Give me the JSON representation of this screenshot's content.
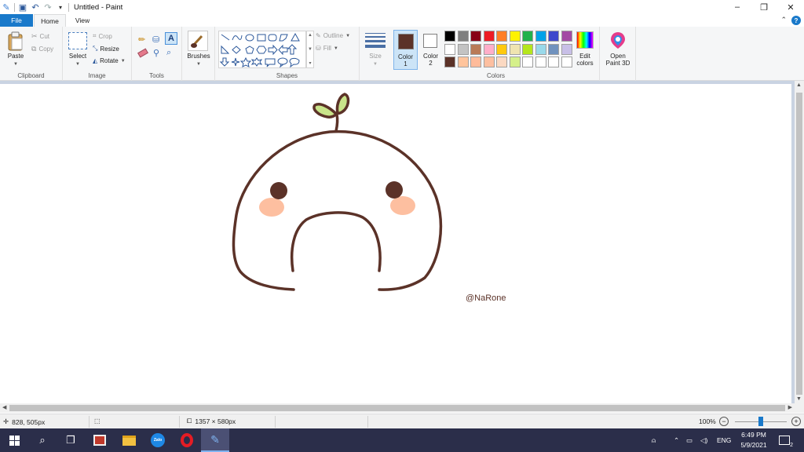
{
  "window": {
    "title": "Untitled - Paint",
    "minimize": "–",
    "restore": "❐",
    "close": "✕"
  },
  "tabs": {
    "file": "File",
    "home": "Home",
    "view": "View"
  },
  "help": "?",
  "ribbon": {
    "clipboard": {
      "group": "Clipboard",
      "paste": "Paste",
      "cut": "Cut",
      "copy": "Copy"
    },
    "image": {
      "group": "Image",
      "select": "Select",
      "crop": "Crop",
      "resize": "Resize",
      "rotate": "Rotate"
    },
    "tools": {
      "group": "Tools"
    },
    "brushes": {
      "label": "Brushes"
    },
    "shapes": {
      "group": "Shapes",
      "outline": "Outline",
      "fill": "Fill"
    },
    "size": {
      "label": "Size"
    },
    "color1": {
      "label": "Color",
      "num": "1",
      "value": "#5b3228"
    },
    "color2": {
      "label": "Color",
      "num": "2",
      "value": "#ffffff"
    },
    "colors": {
      "group": "Colors",
      "edit_line1": "Edit",
      "edit_line2": "colors"
    },
    "paint3d": {
      "line1": "Open",
      "line2": "Paint 3D"
    }
  },
  "palette": {
    "row1": [
      "#000000",
      "#7f7f7f",
      "#880015",
      "#ed1c24",
      "#ff7f27",
      "#fff200",
      "#22b14c",
      "#00a2e8",
      "#3f48cc",
      "#a349a4"
    ],
    "row2": [
      "#ffffff",
      "#c3c3c3",
      "#b97a57",
      "#ffaec9",
      "#ffc90e",
      "#efe4b0",
      "#b5e61d",
      "#99d9ea",
      "#7092be",
      "#c8bfe7"
    ],
    "row3": [
      "#5b3228",
      "#ffc49c",
      "#ffbb9a",
      "#fdbfa0",
      "#fbd9c2",
      "#d5f08a",
      "#ffffff",
      "#ffffff",
      "#ffffff",
      "#ffffff"
    ]
  },
  "canvas": {
    "signature": "@NaRone",
    "stroke_color": "#5b3228",
    "blush_color": "#fdbfa0",
    "leaf_color": "#c9e48a"
  },
  "status": {
    "cursor": "828, 505px",
    "size": "1357 × 580px",
    "zoom": "100%",
    "zoom_level": 1.0
  },
  "taskbar": {
    "time": "6:49 PM",
    "date": "5/9/2021",
    "lang": "ENG",
    "notif_count": "2"
  }
}
